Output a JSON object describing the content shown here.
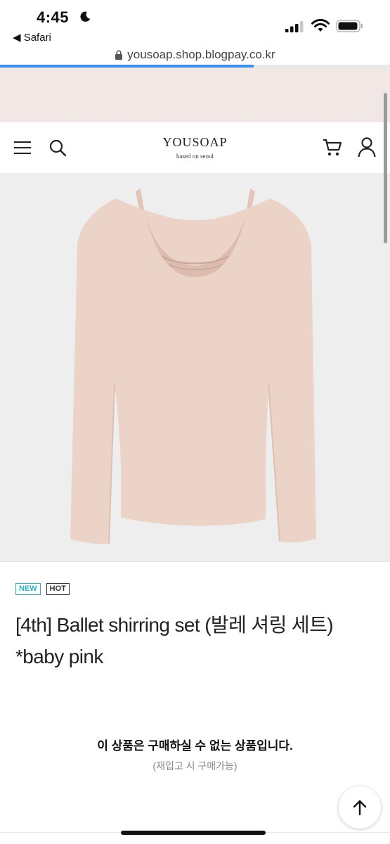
{
  "status_bar": {
    "time": "4:45",
    "back_app": "◀ Safari"
  },
  "browser": {
    "url": "yousoap.shop.blogpay.co.kr",
    "load_progress": 0.65,
    "accent": "#3b8ff7"
  },
  "header": {
    "logo_title": "YOUSOAP",
    "logo_subtitle": "based on seoul"
  },
  "product": {
    "badges": [
      "NEW",
      "HOT"
    ],
    "title": "[4th] Ballet shirring set (발레 셔링 세트) *baby pink",
    "image_subject": "baby pink long-sleeve shirring top",
    "notice": "이 상품은 구매하실 수 없는 상품입니다.",
    "notice_sub": "(재입고 시 구매가능)"
  },
  "colors": {
    "banner": "#f1e8e6",
    "product_pink": "#ecd3c8",
    "badge_new": "#2bb3c0"
  },
  "icons": {
    "menu": "hamburger-icon",
    "search": "search-icon",
    "cart": "cart-icon",
    "account": "user-icon",
    "scroll_top": "arrow-up-icon"
  }
}
